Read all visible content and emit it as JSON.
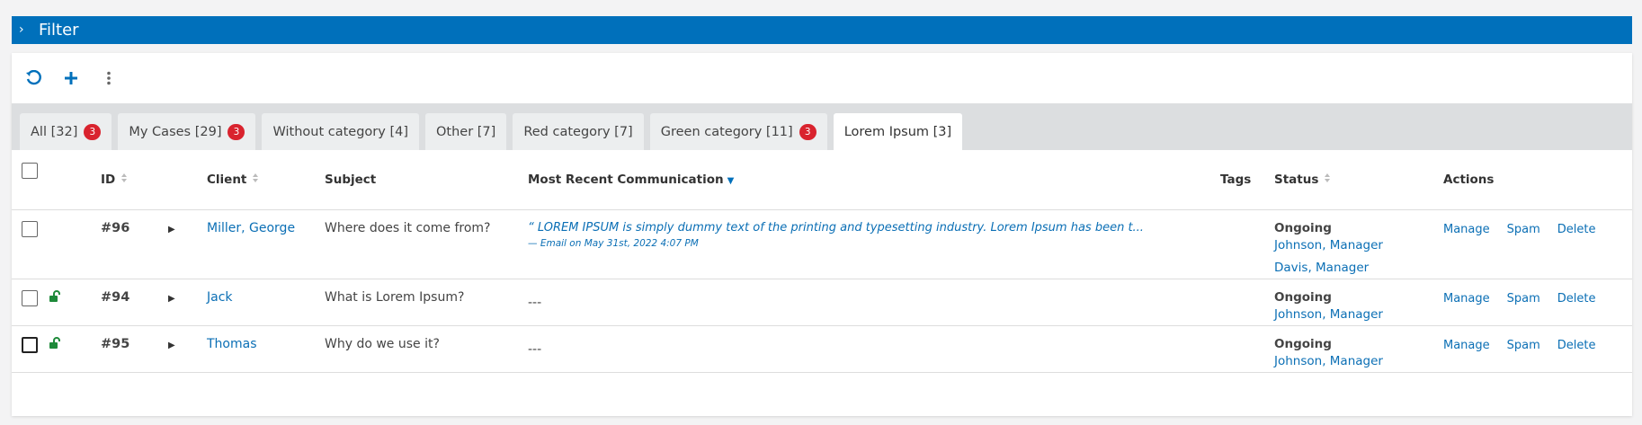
{
  "filter": {
    "label": "Filter"
  },
  "tabs": [
    {
      "label": "All [32]",
      "badge": "3"
    },
    {
      "label": "My Cases [29]",
      "badge": "3"
    },
    {
      "label": "Without category [4]",
      "badge": ""
    },
    {
      "label": "Other [7]",
      "badge": ""
    },
    {
      "label": "Red category [7]",
      "badge": ""
    },
    {
      "label": "Green category [11]",
      "badge": "3"
    },
    {
      "label": "Lorem Ipsum [3]",
      "badge": "",
      "active": true
    }
  ],
  "table": {
    "headers": {
      "id": "ID",
      "client": "Client",
      "subject": "Subject",
      "communication": "Most Recent Communication",
      "tags": "Tags",
      "status": "Status",
      "actions": "Actions"
    },
    "rows": [
      {
        "id": "#96",
        "client": "Miller, George",
        "subject": "Where does it come from?",
        "communication": "“ LOREM IPSUM is simply dummy text of the printing and typesetting industry. Lorem Ipsum has been t...",
        "communication_meta": "— Email on May 31st, 2022 4:07 PM",
        "status": "Ongoing",
        "managers": [
          "Johnson, Manager",
          "Davis, Manager"
        ]
      },
      {
        "id": "#94",
        "client": "Jack",
        "subject": "What is Lorem Ipsum?",
        "communication": "---",
        "status": "Ongoing",
        "managers": [
          "Johnson, Manager"
        ]
      },
      {
        "id": "#95",
        "client": "Thomas",
        "subject": "Why do we use it?",
        "communication": "---",
        "status": "Ongoing",
        "managers": [
          "Johnson, Manager"
        ]
      }
    ],
    "actions": {
      "manage": "Manage",
      "spam": "Spam",
      "delete": "Delete"
    }
  },
  "colors": {
    "accent": "#0070bb",
    "badge": "#d9232e",
    "lock": "#1e8a3a"
  },
  "icons": [
    "refresh-icon",
    "plus-icon",
    "more-vertical-icon",
    "chevron-right-icon",
    "sort-icon",
    "sort-desc-icon",
    "caret-right-icon",
    "unlock-icon"
  ]
}
